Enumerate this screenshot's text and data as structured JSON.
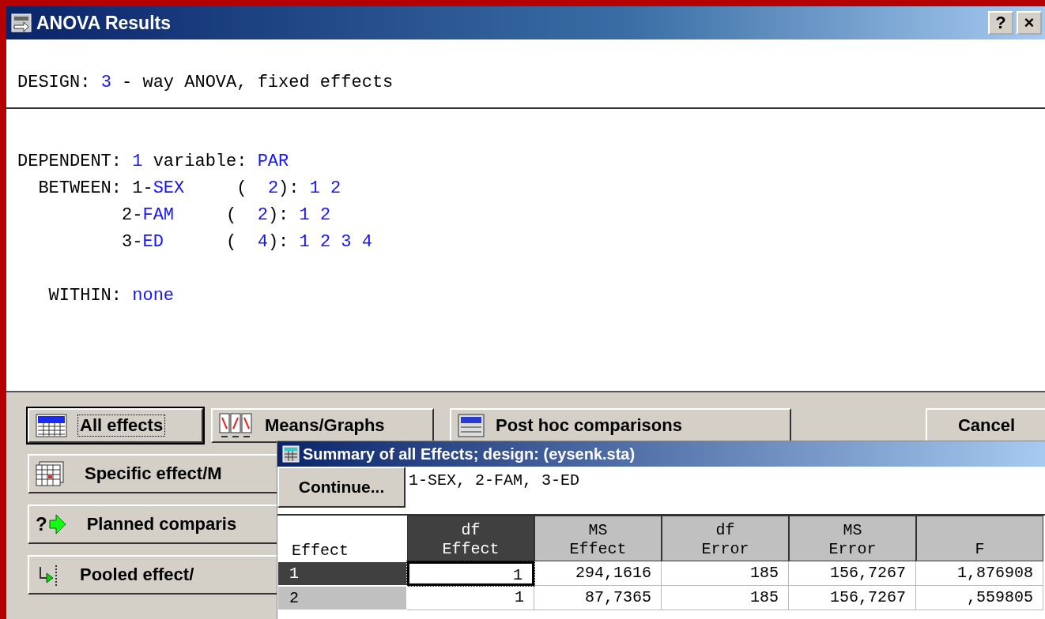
{
  "window": {
    "title": "ANOVA Results",
    "help": "?",
    "close": "×"
  },
  "design": [
    {
      "text": "DESIGN: ",
      "kind": "label"
    },
    {
      "text": "3",
      "kind": "value"
    },
    {
      "text": " - way ANOVA, fixed effects",
      "kind": "label"
    }
  ],
  "spec_lines": [
    [
      {
        "text": "DEPENDENT: ",
        "kind": "label"
      },
      {
        "text": "1",
        "kind": "value"
      },
      {
        "text": " variable: ",
        "kind": "label"
      },
      {
        "text": "PAR",
        "kind": "value"
      }
    ],
    [
      {
        "text": "  BETWEEN: 1-",
        "kind": "label"
      },
      {
        "text": "SEX",
        "kind": "value"
      },
      {
        "text": "     (  ",
        "kind": "label"
      },
      {
        "text": "2",
        "kind": "value"
      },
      {
        "text": "): ",
        "kind": "label"
      },
      {
        "text": "1 2",
        "kind": "value"
      }
    ],
    [
      {
        "text": "          2-",
        "kind": "label"
      },
      {
        "text": "FAM",
        "kind": "value"
      },
      {
        "text": "     (  ",
        "kind": "label"
      },
      {
        "text": "2",
        "kind": "value"
      },
      {
        "text": "): ",
        "kind": "label"
      },
      {
        "text": "1 2",
        "kind": "value"
      }
    ],
    [
      {
        "text": "          3-",
        "kind": "label"
      },
      {
        "text": "ED",
        "kind": "value"
      },
      {
        "text": "      (  ",
        "kind": "label"
      },
      {
        "text": "4",
        "kind": "value"
      },
      {
        "text": "): ",
        "kind": "label"
      },
      {
        "text": "1 2 3 4",
        "kind": "value"
      }
    ]
  ],
  "within": [
    {
      "text": "   WITHIN: ",
      "kind": "label"
    },
    {
      "text": "none",
      "kind": "value"
    }
  ],
  "top_buttons": [
    {
      "label": "All effects",
      "default": true
    },
    {
      "label": "Means/Graphs",
      "default": false
    },
    {
      "label": "Post hoc comparisons",
      "default": false
    }
  ],
  "cancel": "Cancel",
  "side_buttons": [
    {
      "label": "Specific effect/M"
    },
    {
      "label": "Planned comparis",
      "icon_text": "?"
    },
    {
      "label": "Pooled effect/"
    }
  ],
  "summary": {
    "title": "Summary of all Effects; design: (eysenk.sta)",
    "continue": "Continue...",
    "legend": "1-SEX, 2-FAM, 3-ED",
    "corner": "Effect",
    "columns": [
      {
        "lines": [
          "df",
          "Effect"
        ],
        "selected": true
      },
      {
        "lines": [
          "MS",
          "Effect"
        ],
        "selected": false
      },
      {
        "lines": [
          "df",
          "Error"
        ],
        "selected": false
      },
      {
        "lines": [
          "MS",
          "Error"
        ],
        "selected": false
      },
      {
        "lines": [
          "F"
        ],
        "selected": false
      }
    ],
    "rows": [
      {
        "label": "1",
        "selected": true,
        "cells": [
          "1",
          "294,1616",
          "185",
          "156,7267",
          "1,876908"
        ]
      },
      {
        "label": "2",
        "selected": false,
        "cells": [
          "1",
          "87,7365",
          "185",
          "156,7267",
          ",559805"
        ]
      }
    ]
  }
}
